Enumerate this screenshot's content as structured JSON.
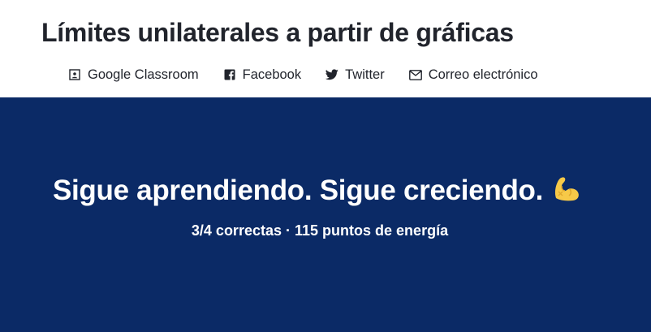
{
  "header": {
    "title": "Límites unilaterales a partir de gráficas",
    "share": [
      {
        "label": "Google Classroom",
        "icon": "google-classroom-icon"
      },
      {
        "label": "Facebook",
        "icon": "facebook-icon"
      },
      {
        "label": "Twitter",
        "icon": "twitter-icon"
      },
      {
        "label": "Correo electrónico",
        "icon": "email-icon"
      }
    ]
  },
  "banner": {
    "headline": "Sigue aprendiendo. Sigue creciendo.",
    "emoji_icon": "flexed-biceps-icon",
    "stats": {
      "correct": "3/4 correctas",
      "separator": "·",
      "points": "115 puntos de energía"
    },
    "background_color": "#0b2a66",
    "emoji_color": "#f7c948"
  }
}
